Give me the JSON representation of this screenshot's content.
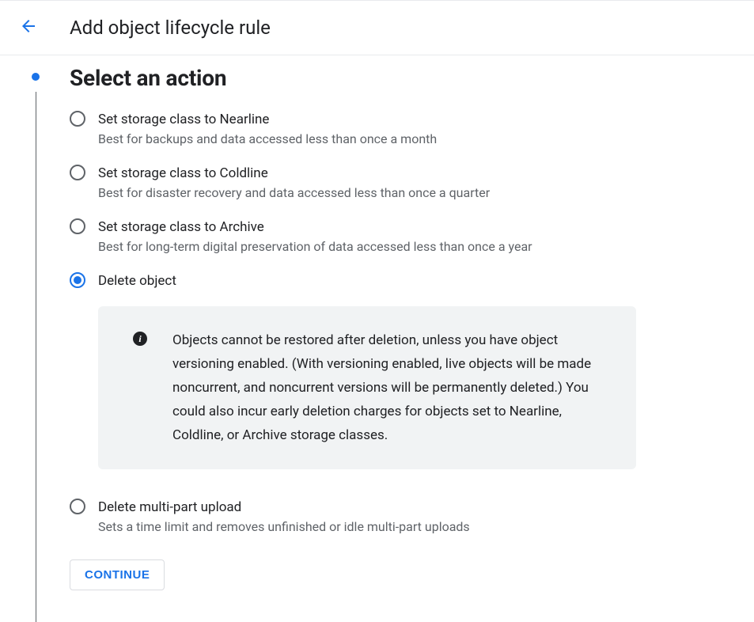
{
  "header": {
    "title": "Add object lifecycle rule"
  },
  "section": {
    "title": "Select an action"
  },
  "options": [
    {
      "label": "Set storage class to Nearline",
      "desc": "Best for backups and data accessed less than once a month",
      "selected": false
    },
    {
      "label": "Set storage class to Coldline",
      "desc": "Best for disaster recovery and data accessed less than once a quarter",
      "selected": false
    },
    {
      "label": "Set storage class to Archive",
      "desc": "Best for long-term digital preservation of data accessed less than once a year",
      "selected": false
    },
    {
      "label": "Delete object",
      "desc": "",
      "selected": true
    },
    {
      "label": "Delete multi-part upload",
      "desc": "Sets a time limit and removes unfinished or idle multi-part uploads",
      "selected": false
    }
  ],
  "info": {
    "text": "Objects cannot be restored after deletion, unless you have object versioning enabled. (With versioning enabled, live objects will be made noncurrent, and noncurrent versions will be permanently deleted.) You could also incur early deletion charges for objects set to Nearline, Coldline, or Archive storage classes."
  },
  "buttons": {
    "continue": "CONTINUE"
  }
}
